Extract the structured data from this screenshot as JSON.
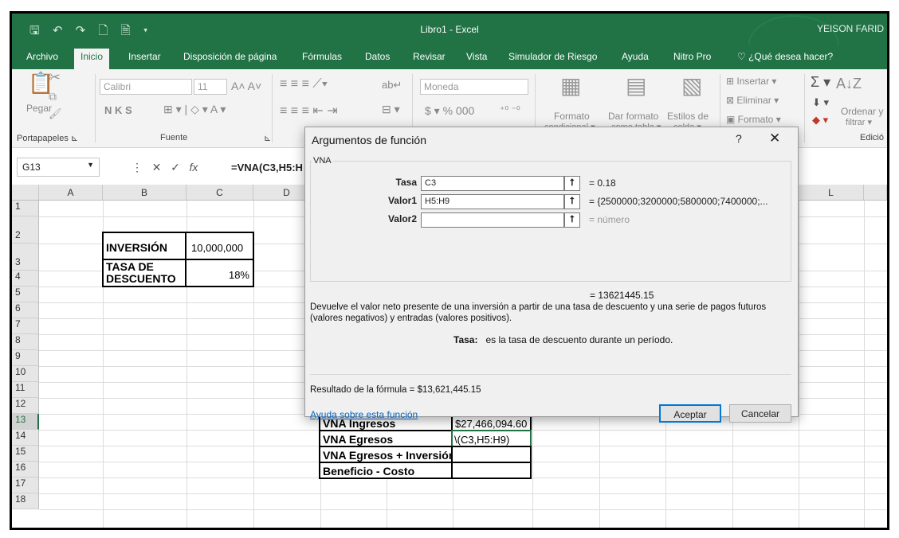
{
  "titlebar": {
    "qat_icons": "🖫 ↶ ↷ 🗋 🗎 ▾",
    "title": "Libro1  -  Excel",
    "user": "YEISON FARID"
  },
  "tabs": [
    "Archivo",
    "Inicio",
    "Insertar",
    "Disposición de página",
    "Fórmulas",
    "Datos",
    "Revisar",
    "Vista",
    "Simulador de Riesgo",
    "Ayuda",
    "Nitro Pro",
    "¿Qué desea hacer?"
  ],
  "ribbon": {
    "paste": "Pegar",
    "font_name": "Calibri",
    "font_size": "11",
    "bold_italic_underline": "N  K  S",
    "number_format": "Moneda",
    "currency_row": "$  ▾  %  000",
    "cond_format": "Formato",
    "cond_format2": "condicional ▾",
    "table_format": "Dar formato",
    "table_format2": "como tabla ▾",
    "cell_styles": "Estilos de",
    "cell_styles2": "celda ▾",
    "insert": "Insertar",
    "delete": "Eliminar",
    "format": "Formato",
    "sort": "Ordenar y",
    "sort2": "filtrar ▾",
    "groups": {
      "clipboard": "Portapapeles",
      "font": "Fuente",
      "editing": "Edició"
    }
  },
  "formula_bar": {
    "name_box": "G13",
    "fx": "fx",
    "formula": "=VNA(C3,H5:H"
  },
  "columns": [
    "A",
    "B",
    "C",
    "D",
    "",
    "",
    "",
    "",
    "",
    "",
    "L"
  ],
  "rows": [
    "1",
    "2",
    "3",
    "4",
    "5",
    "6",
    "7",
    "8",
    "9",
    "10",
    "11",
    "12",
    "13",
    "14",
    "15",
    "16",
    "17",
    "18"
  ],
  "cells": {
    "inversion_label": "INVERSIÓN",
    "inversion_value": "10,000,000",
    "tasa_label_1": "TASA DE",
    "tasa_label_2": "DESCUENTO",
    "tasa_value": "18%",
    "vna_ingresos_label": "VNA Ingresos",
    "vna_ingresos_value": "$27,466,094.60",
    "vna_egresos_label": "VNA Egresos",
    "vna_egresos_value": "\\(C3,H5:H9)",
    "vna_egresos_inv_label": "VNA Egresos + Inversión",
    "beneficio_label": "Beneficio - Costo"
  },
  "dialog": {
    "title": "Argumentos de función",
    "help_symbol": "?",
    "close_symbol": "✕",
    "function_name": "VNA",
    "args": [
      {
        "label": "Tasa",
        "value": "C3",
        "result": "=  0.18"
      },
      {
        "label": "Valor1",
        "value": "H5:H9",
        "result": "=  {2500000;3200000;5800000;7400000;..."
      },
      {
        "label": "Valor2",
        "value": "",
        "result": "=  número"
      }
    ],
    "total_result": "=  13621445.15",
    "description_1": "Devuelve el valor neto presente de una inversión a partir de una tasa de descuento y una serie de pagos futuros",
    "description_2": "(valores negativos) y entradas (valores positivos).",
    "arg_help_label": "Tasa:",
    "arg_help_text": "es la tasa de descuento durante un período.",
    "formula_result": "Resultado de la fórmula =   $13,621,445.15",
    "help_link": "Ayuda sobre esta función",
    "ok": "Aceptar",
    "cancel": "Cancelar"
  },
  "colors": {
    "excel_green": "#217346",
    "selection_green": "#217346",
    "link_blue": "#0563c1"
  }
}
